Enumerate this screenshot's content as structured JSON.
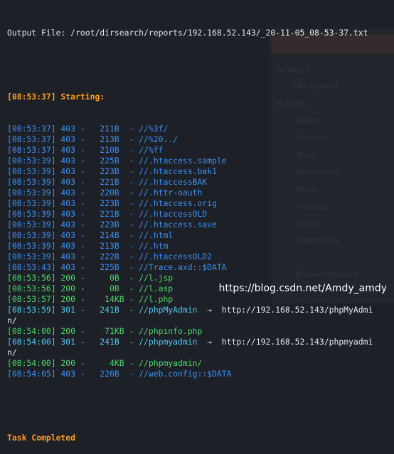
{
  "output_file_line": "Output File: /root/dirsearch/reports/192.168.52.143/_20-11-05_08-53-37.txt",
  "starting_line": "[08:53:37] Starting:",
  "log_lines": [
    {
      "text": "[08:53:37] 403 -   211B  - //%3f/",
      "status": "403"
    },
    {
      "text": "[08:53:37] 403 -   213B  - //%20../",
      "status": "403"
    },
    {
      "text": "[08:53:37] 403 -   210B  - //%ff",
      "status": "403"
    },
    {
      "text": "[08:53:39] 403 -   225B  - //.htaccess.sample",
      "status": "403"
    },
    {
      "text": "[08:53:39] 403 -   223B  - //.htaccess.bak1",
      "status": "403"
    },
    {
      "text": "[08:53:39] 403 -   221B  - //.htaccessBAK",
      "status": "403"
    },
    {
      "text": "[08:53:39] 403 -   220B  - //.httr-oauth",
      "status": "403"
    },
    {
      "text": "[08:53:39] 403 -   223B  - //.htaccess.orig",
      "status": "403"
    },
    {
      "text": "[08:53:39] 403 -   221B  - //.htaccessOLD",
      "status": "403"
    },
    {
      "text": "[08:53:39] 403 -   223B  - //.htaccess.save",
      "status": "403"
    },
    {
      "text": "[08:53:39] 403 -   214B  - //.html",
      "status": "403"
    },
    {
      "text": "[08:53:39] 403 -   213B  - //.htm",
      "status": "403"
    },
    {
      "text": "[08:53:39] 403 -   222B  - //.htaccessOLD2",
      "status": "403"
    },
    {
      "text": "[08:53:43] 403 -   225B  - //Trace.axd::$DATA",
      "status": "403"
    },
    {
      "text": "[08:53:56] 200 -     0B  - //l.jsp",
      "status": "200"
    },
    {
      "text": "[08:53:56] 200 -     0B  - //l.asp",
      "status": "200"
    },
    {
      "text": "[08:53:57] 200 -    14KB - //l.php",
      "status": "200"
    },
    {
      "text": "[08:53:59] 301 -   241B  - //phpMyAdmin",
      "status": "301",
      "redirect": "  →  http://192.168.52.143/phpMyAdmi"
    },
    {
      "text": "n/",
      "status": "plain"
    },
    {
      "text": "[08:54:00] 200 -    71KB - //phpinfo.php",
      "status": "200"
    },
    {
      "text": "[08:54:00] 301 -   241B  - //phpmyadmin",
      "status": "301",
      "redirect": "  →  http://192.168.52.143/phpmyadmi"
    },
    {
      "text": "n/",
      "status": "plain"
    },
    {
      "text": "[08:54:00] 200 -     4KB - //phpmyadmin/",
      "status": "200"
    },
    {
      "text": "[08:54:05] 403 -   226B  - //web.config::$DATA",
      "status": "403"
    }
  ],
  "task_completed": "Task Completed",
  "watermark": "https://blog.csdn.net/Amdy_amdy",
  "ghost_text": {
    "places": "PLACES",
    "devices": "DEVICES",
    "home": "Home",
    "desktop": "Desktop",
    "trash": "Trash",
    "documents": "Documents",
    "music": "Music",
    "pictures": "Pictures",
    "videos": "Videos",
    "downloads": "Downloads",
    "browse_network": "Browse Network",
    "filesystem": "File System"
  },
  "colors": {
    "background": "#1d2026",
    "status_403": "#3b8ff0",
    "status_200": "#4bd96a",
    "status_301": "#4ec9f0",
    "accent_orange": "#ff9b1f",
    "text": "#e6e6e6"
  }
}
